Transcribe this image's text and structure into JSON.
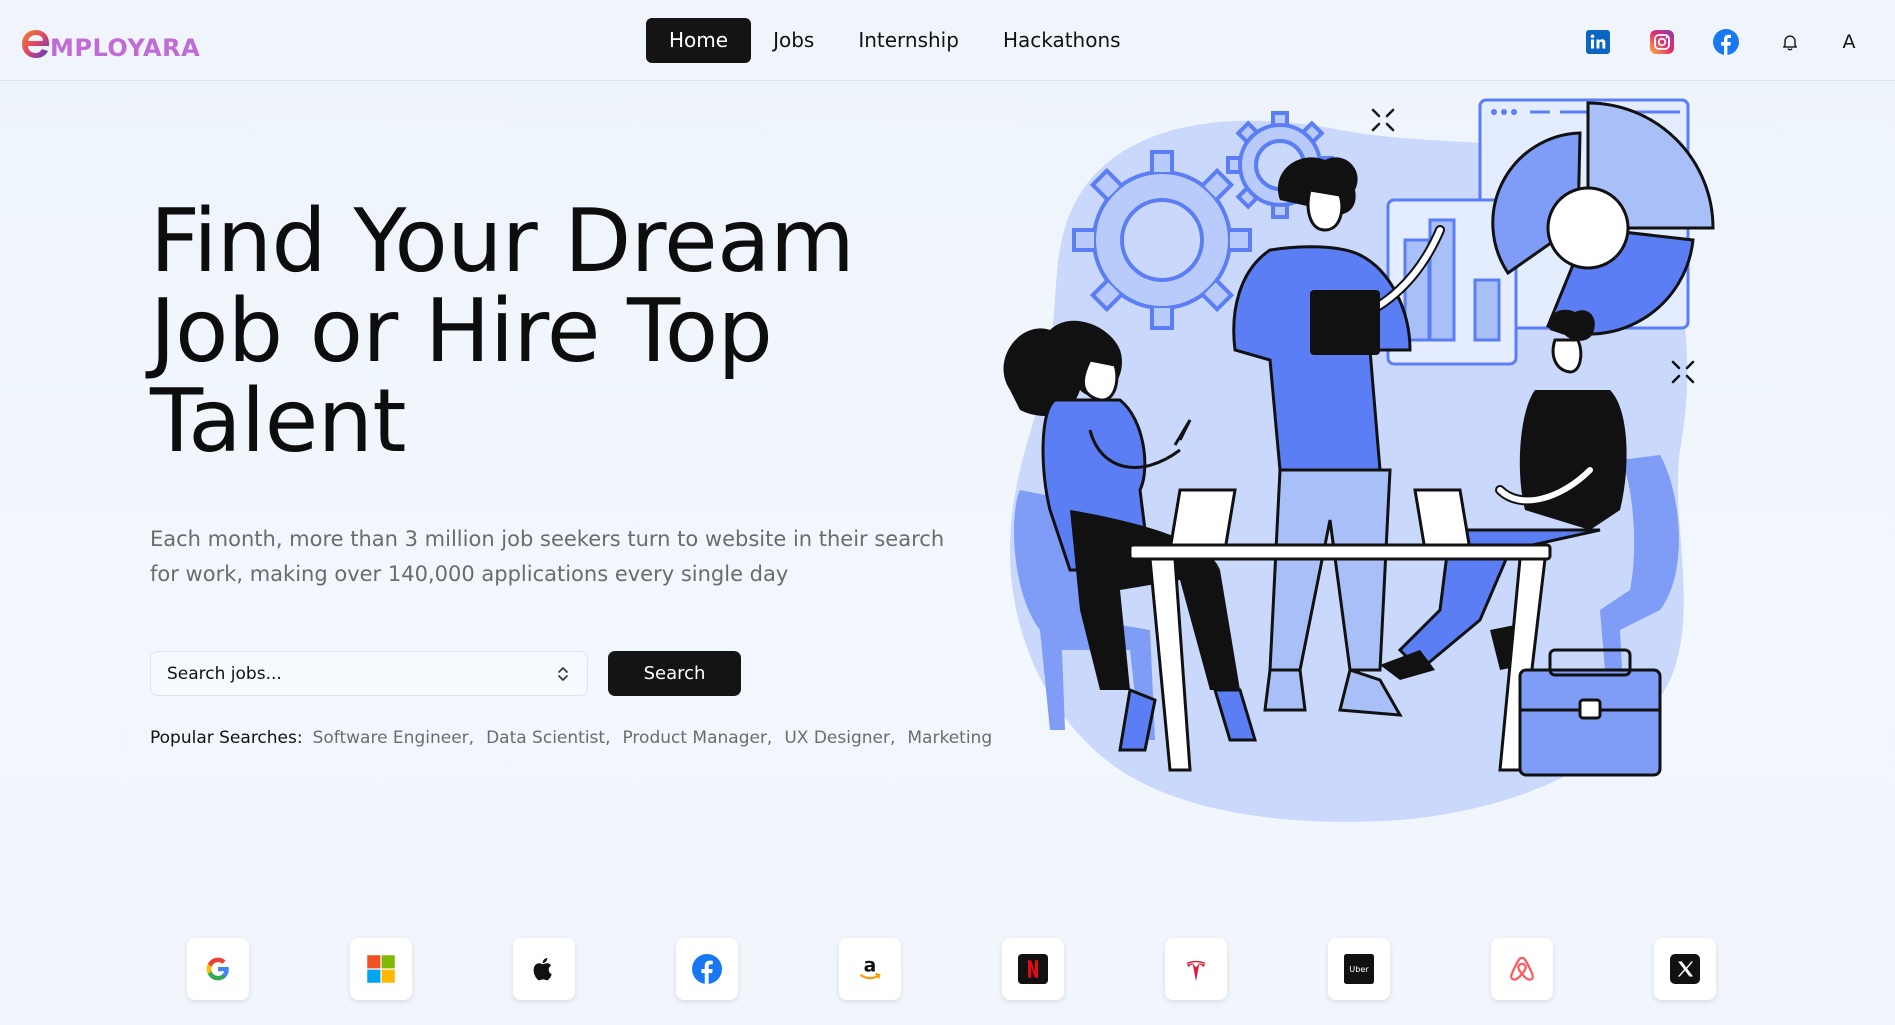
{
  "brand": {
    "name": "MPLOYARA",
    "mark_letter": "e"
  },
  "nav": {
    "links": [
      {
        "label": "Home",
        "active": true
      },
      {
        "label": "Jobs",
        "active": false
      },
      {
        "label": "Internship",
        "active": false
      },
      {
        "label": "Hackathons",
        "active": false
      }
    ],
    "social": [
      "linkedin-icon",
      "instagram-icon",
      "facebook-icon"
    ],
    "avatar_initial": "A"
  },
  "hero": {
    "title": "Find Your Dream Job or Hire Top Talent",
    "subtitle": "Each month, more than 3 million job seekers turn to website in their search for work, making over 140,000 applications every single day",
    "search": {
      "placeholder": "Search jobs...",
      "value": "",
      "button": "Search"
    },
    "popular_label": "Popular Searches:",
    "popular": [
      "Software Engineer,",
      "Data Scientist,",
      "Product Manager,",
      "UX Designer,",
      "Marketing"
    ]
  },
  "companies": [
    "google",
    "microsoft",
    "apple",
    "facebook",
    "amazon",
    "netflix",
    "tesla",
    "uber",
    "airbnb",
    "x"
  ],
  "colors": {
    "accent": "#5b7ef5",
    "accent_light": "#c9d8ff",
    "dark": "#141414"
  }
}
